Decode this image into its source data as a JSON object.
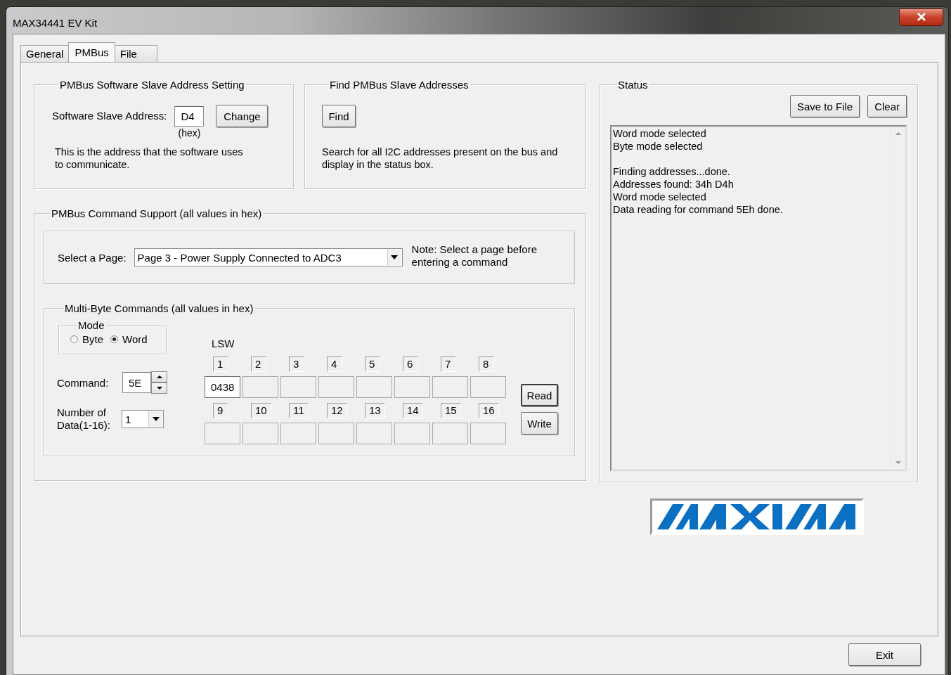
{
  "window": {
    "title": "MAX34441 EV Kit"
  },
  "tabs": [
    {
      "label": "General",
      "selected": false
    },
    {
      "label": "PMBus",
      "selected": true
    },
    {
      "label": "File",
      "selected": false
    }
  ],
  "address_group": {
    "title": "PMBus Software Slave Address Setting",
    "label": "Software Slave Address:",
    "value": "D4",
    "unit": "(hex)",
    "button": "Change",
    "description": "This is the address that the software uses to communicate."
  },
  "find_group": {
    "title": "Find PMBus Slave Addresses",
    "button": "Find",
    "description": "Search for all I2C addresses present on the bus and display in the status box."
  },
  "command_support": {
    "title": "PMBus Command Support (all values in hex)",
    "page_label": "Select a Page:",
    "page_value": "Page 3 - Power Supply Connected to ADC3",
    "note": "Note: Select a page before entering a command",
    "multi_byte": {
      "title": "Multi-Byte Commands (all values in hex)",
      "mode": {
        "title": "Mode",
        "options": [
          {
            "label": "Byte",
            "selected": false
          },
          {
            "label": "Word",
            "selected": true
          }
        ]
      },
      "command_label": "Command:",
      "command_value": "5E",
      "count_label": "Number of Data(1-16):",
      "count_value": "1",
      "lsw_label": "LSW",
      "data_rows": [
        {
          "slots": [
            {
              "index": "1",
              "value": "0438"
            },
            {
              "index": "2"
            },
            {
              "index": "3"
            },
            {
              "index": "4"
            },
            {
              "index": "5"
            },
            {
              "index": "6"
            },
            {
              "index": "7"
            },
            {
              "index": "8"
            }
          ]
        },
        {
          "slots": [
            {
              "index": "9"
            },
            {
              "index": "10"
            },
            {
              "index": "11"
            },
            {
              "index": "12"
            },
            {
              "index": "13"
            },
            {
              "index": "14"
            },
            {
              "index": "15"
            },
            {
              "index": "16"
            }
          ]
        }
      ],
      "buttons": [
        "Read",
        "Write"
      ]
    }
  },
  "status": {
    "title": "Status",
    "buttons": [
      "Save to File",
      "Clear"
    ],
    "log": [
      [
        "Word mode selected",
        "Byte mode selected"
      ],
      [
        "Finding addresses...done.",
        "Addresses found: 34h D4h",
        "Word mode selected",
        "Data reading for command 5Eh done."
      ]
    ]
  },
  "exit_button": "Exit"
}
